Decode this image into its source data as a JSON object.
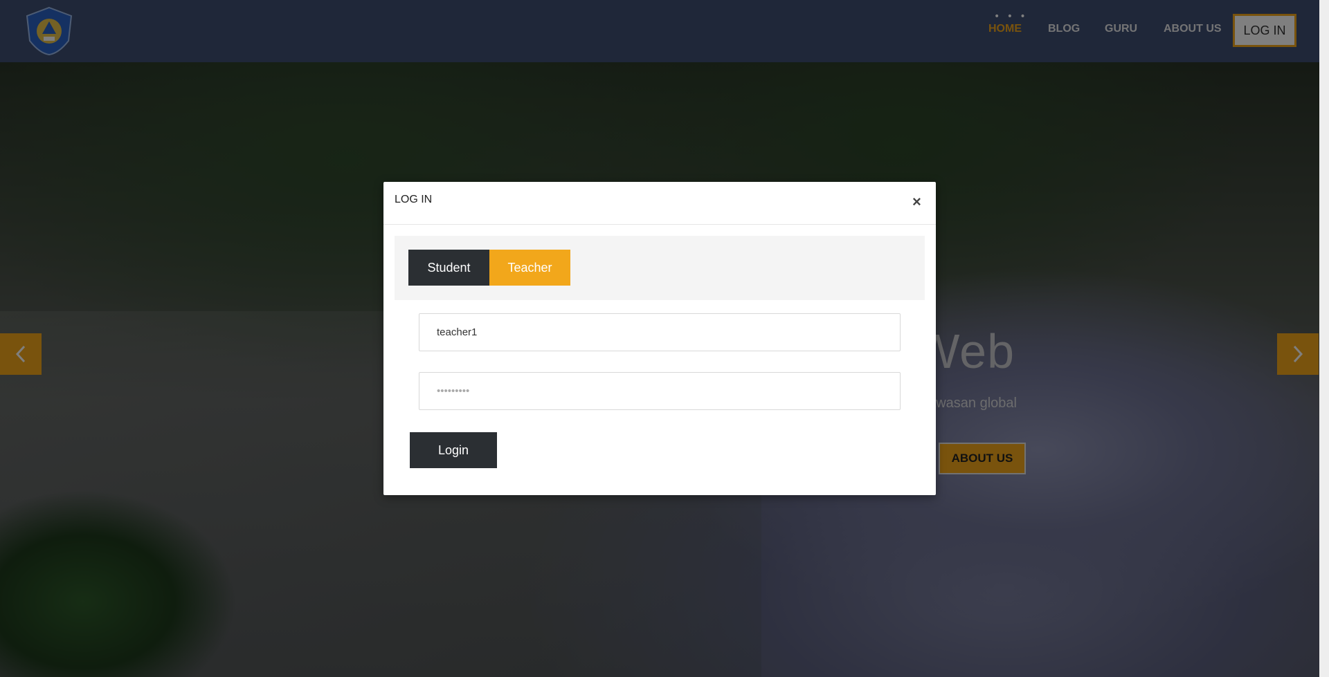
{
  "navbar": {
    "items": [
      "HOME",
      "BLOG",
      "GURU",
      "ABOUT US"
    ],
    "login_label": "LOG IN",
    "more_indicator": "• • •",
    "active_color": "#f2a71b",
    "bg_color": "#3f4f73"
  },
  "hero": {
    "headline_fragment": "n Web",
    "subtitle_fragment": "rwawasan global",
    "about_button_label": "ABOUT US",
    "prev_icon": "chevron-left-icon",
    "next_icon": "chevron-right-icon"
  },
  "modal": {
    "title": "LOG IN",
    "close_symbol": "×",
    "tabs": {
      "student": "Student",
      "teacher": "Teacher"
    },
    "selected_tab": "Teacher",
    "username_value": "teacher1",
    "password_placeholder": "•••••••••",
    "login_button": "Login",
    "accent_color": "#f2a71b",
    "dark_color": "#2b2f33"
  }
}
